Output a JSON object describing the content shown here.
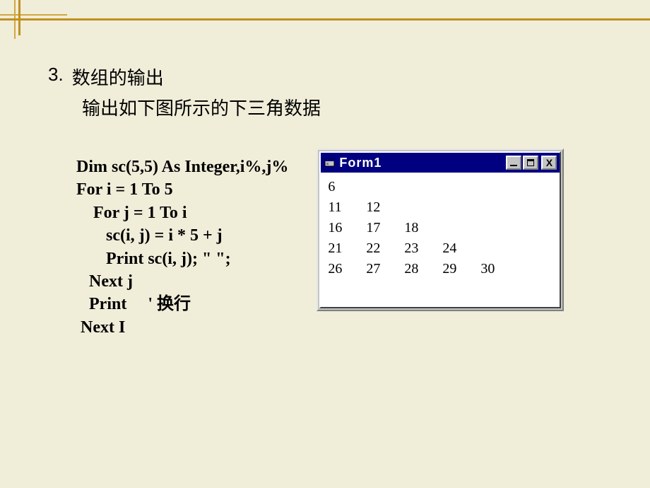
{
  "heading": {
    "number": "3.",
    "title": "数组的输出",
    "subtitle": "输出如下图所示的下三角数据"
  },
  "code": {
    "l1": "Dim sc(5,5) As Integer,i%,j%",
    "l2": "For i = 1 To 5",
    "l3": "    For j = 1 To i",
    "l4": "       sc(i, j) = i * 5 + j",
    "l5": "       Print sc(i, j); \" \";",
    "l6": "   Next j",
    "l7": "   Print     ' 换行",
    "l8": " Next I"
  },
  "form": {
    "title": "Form1",
    "output": [
      [
        "6"
      ],
      [
        "11",
        "12"
      ],
      [
        "16",
        "17",
        "18"
      ],
      [
        "21",
        "22",
        "23",
        "24"
      ],
      [
        "26",
        "27",
        "28",
        "29",
        "30"
      ]
    ]
  }
}
